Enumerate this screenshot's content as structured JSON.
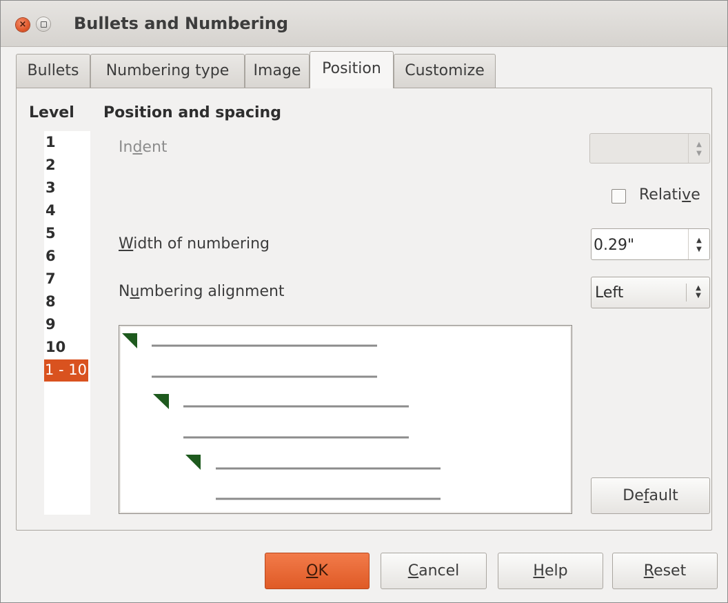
{
  "window": {
    "title": "Bullets and Numbering",
    "close_glyph": "×"
  },
  "tabs": [
    {
      "label": "Bullets"
    },
    {
      "label": "Numbering type"
    },
    {
      "label": "Image"
    },
    {
      "label": "Position"
    },
    {
      "label": "Customize"
    }
  ],
  "active_tab": "Position",
  "level": {
    "header": "Level",
    "items": [
      "1",
      "2",
      "3",
      "4",
      "5",
      "6",
      "7",
      "8",
      "9",
      "10",
      "1 - 10"
    ],
    "selected": "1 - 10"
  },
  "position": {
    "header": "Position and spacing",
    "indent": {
      "label_a": "In",
      "label_u": "d",
      "label_b": "ent",
      "value": ""
    },
    "relative": {
      "label_a": "Relati",
      "label_u": "v",
      "label_b": "e",
      "checked": false
    },
    "width": {
      "label_a": "",
      "label_u": "W",
      "label_b": "idth of numbering",
      "value": "0.29\""
    },
    "alignment": {
      "label_a": "N",
      "label_u": "u",
      "label_b": "mbering alignment",
      "value": "Left"
    },
    "default_button": {
      "a": "De",
      "u": "f",
      "b": "ault"
    }
  },
  "buttons": {
    "ok": {
      "a": "",
      "u": "O",
      "b": "K"
    },
    "cancel": {
      "a": "",
      "u": "C",
      "b": "ancel"
    },
    "help": {
      "a": "",
      "u": "H",
      "b": "elp"
    },
    "reset": {
      "a": "",
      "u": "R",
      "b": "eset"
    }
  },
  "icons": {
    "spin_up": "▲",
    "spin_down": "▼"
  },
  "colors": {
    "accent": "#df5a26",
    "selection": "#d9521f",
    "preview_marker": "#1e5a1e",
    "preview_line": "#8c8c8c"
  }
}
